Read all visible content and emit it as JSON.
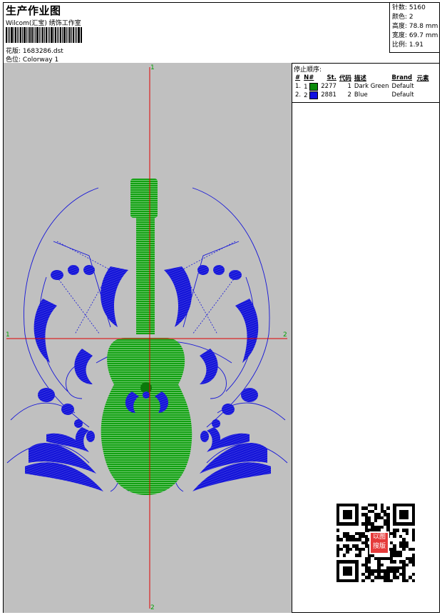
{
  "header": {
    "title": "生产作业图",
    "subtitle": "Wilcom(汇宝) 绣饰工作室",
    "design_label": "花版:",
    "design_value": "1683286.dst",
    "colorway_label": "色位:",
    "colorway_value": "Colorway 1"
  },
  "stats": {
    "stitches_label": "针数:",
    "stitches_value": "5160",
    "colors_label": "颜色:",
    "colors_value": "2",
    "height_label": "高度:",
    "height_value": "78.8 mm",
    "width_label": "宽度:",
    "width_value": "69.7 mm",
    "scale_label": "比例:",
    "scale_value": "1.91"
  },
  "axes": {
    "top": "1",
    "bottom": "2",
    "left": "1",
    "right": "2"
  },
  "stop_sequence": {
    "title": "停止顺序:",
    "headers": [
      "#",
      "N#",
      "St.",
      "代码",
      "描述",
      "Brand",
      "元素"
    ],
    "rows": [
      {
        "num": "1.",
        "needle": "1",
        "color": "#0a8a0a",
        "st": "2277",
        "code": "1",
        "desc": "Dark Green",
        "brand": "Default"
      },
      {
        "num": "2.",
        "needle": "2",
        "color": "#1010e0",
        "st": "2881",
        "code": "2",
        "desc": "Blue",
        "brand": "Default"
      }
    ]
  },
  "colors": {
    "design_bg": "#c0c0c0",
    "guitar": "#12a012",
    "ornament": "#1414d8",
    "crosshair": "#e00000",
    "axis_label": "#00a000"
  },
  "qr": {
    "seal_text": "以图搜版"
  }
}
